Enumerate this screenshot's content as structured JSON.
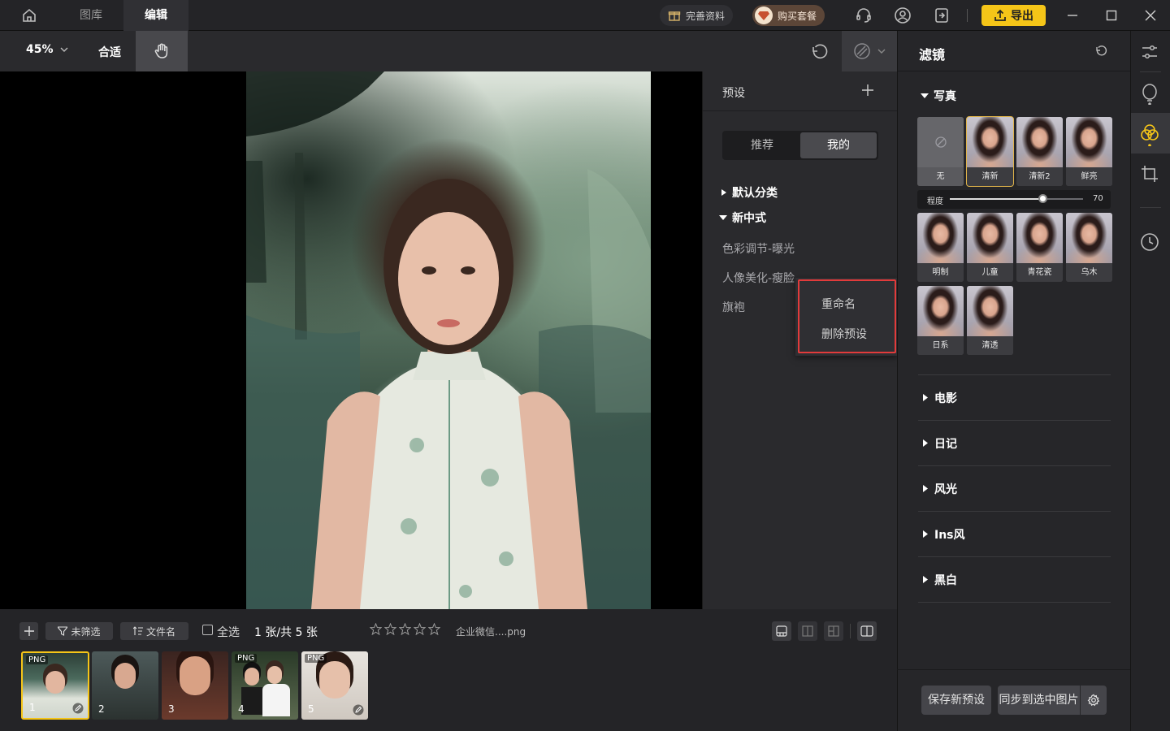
{
  "titlebar": {
    "tabs": [
      "图库",
      "编辑"
    ],
    "profile_label": "完善资料",
    "buy_label": "购买套餐",
    "export_label": "导出"
  },
  "toolbar": {
    "zoom": "45%",
    "fit_label": "合适"
  },
  "preset_panel": {
    "title": "预设",
    "tabs": [
      "推荐",
      "我的"
    ],
    "active_tab": "我的",
    "groups": [
      {
        "label": "默认分类",
        "expanded": false
      },
      {
        "label": "新中式",
        "expanded": true
      }
    ],
    "items": [
      "色彩调节-曝光",
      "人像美化-瘦脸",
      "旗袍"
    ],
    "context_menu": [
      "重命名",
      "删除预设"
    ]
  },
  "filter_panel": {
    "title": "滤镜",
    "section": "写真",
    "row1": [
      "无",
      "清新",
      "清新2",
      "鲜亮"
    ],
    "selected": "清新",
    "intensity_label": "程度",
    "intensity_value": "70",
    "intensity_fraction": 0.7,
    "row2": [
      "明制",
      "儿童",
      "青花瓷",
      "乌木"
    ],
    "row3": [
      "日系",
      "清透"
    ],
    "categories": [
      "电影",
      "日记",
      "风光",
      "Ins风",
      "黑白"
    ],
    "save_label": "保存新预设",
    "sync_label": "同步到选中图片"
  },
  "bottom": {
    "filter_label": "未筛选",
    "sort_label": "文件名",
    "select_all_label": "全选",
    "count_label": "1 张/共 5 张",
    "filename": "企业微信....png",
    "thumbs": [
      {
        "num": "1",
        "badge": "PNG"
      },
      {
        "num": "2",
        "badge": ""
      },
      {
        "num": "3",
        "badge": ""
      },
      {
        "num": "4",
        "badge": "PNG"
      },
      {
        "num": "5",
        "badge": "PNG"
      }
    ]
  },
  "colors": {
    "accent": "#f5c518",
    "highlight_border": "#e23b3b",
    "selected_tile": "#e0b44a"
  }
}
